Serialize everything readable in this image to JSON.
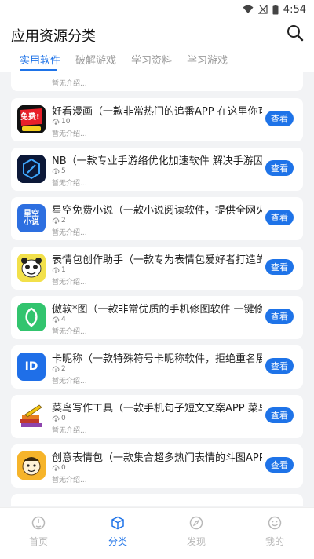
{
  "status_bar": {
    "time": "4:54"
  },
  "header": {
    "title": "应用资源分类",
    "search_icon": "search-icon"
  },
  "tabs": [
    {
      "label": "实用软件",
      "active": true
    },
    {
      "label": "破解游戏",
      "active": false
    },
    {
      "label": "学习资料",
      "active": false
    },
    {
      "label": "学习游戏",
      "active": false
    }
  ],
  "partial_top_card": {
    "desc": "暂无介绍..."
  },
  "apps": [
    {
      "name": "好看漫画（一款非常热门的追番APP 在这里你可以",
      "downloads": "10",
      "desc": "暂无介绍...",
      "button": "查看",
      "icon": "red-comic-icon",
      "icon_text": "免费!"
    },
    {
      "name": "NB（一款专业手游络优化加速软件 解决手游因络卡",
      "downloads": "5",
      "desc": "暂无介绍...",
      "button": "查看",
      "icon": "cube-logo-icon",
      "icon_text": ""
    },
    {
      "name": "星空免费小说（一款小说阅读软件，提供全网火爆",
      "downloads": "2",
      "desc": "暂无介绍...",
      "button": "查看",
      "icon": "novel-book-icon",
      "icon_text": "星空\n小说"
    },
    {
      "name": "表情包创作助手（一款专为表情包爱好者打造的制",
      "downloads": "1",
      "desc": "暂无介绍...",
      "button": "查看",
      "icon": "panda-meme-icon",
      "icon_text": ""
    },
    {
      "name": "傲软*图（一款非常优质的手机修图软件 一键修图",
      "downloads": "4",
      "desc": "暂无介绍...",
      "button": "查看",
      "icon": "green-leaf-icon",
      "icon_text": ""
    },
    {
      "name": "卡昵称（一款特殊符号卡昵称软件，拒绝重名展示",
      "downloads": "2",
      "desc": "暂无介绍...",
      "button": "查看",
      "icon": "id-badge-icon",
      "icon_text": "ID"
    },
    {
      "name": "菜鸟写作工具（一款手机句子短文文案APP 菜鸟写",
      "downloads": "0",
      "desc": "暂无介绍...",
      "button": "查看",
      "icon": "books-pencil-icon",
      "icon_text": ""
    },
    {
      "name": "创意表情包（一款集合超多热门表情的斗图APP 拥",
      "downloads": "0",
      "desc": "暂无介绍...",
      "button": "查看",
      "icon": "meme-face-icon",
      "icon_text": ""
    }
  ],
  "bottom_nav": [
    {
      "label": "首页",
      "icon": "home-icon",
      "active": false
    },
    {
      "label": "分类",
      "icon": "cube-icon",
      "active": true
    },
    {
      "label": "发现",
      "icon": "compass-icon",
      "active": false
    },
    {
      "label": "我的",
      "icon": "smile-icon",
      "active": false
    }
  ],
  "colors": {
    "accent": "#1e73e8",
    "background": "#f2f3f5",
    "card": "#ffffff"
  }
}
